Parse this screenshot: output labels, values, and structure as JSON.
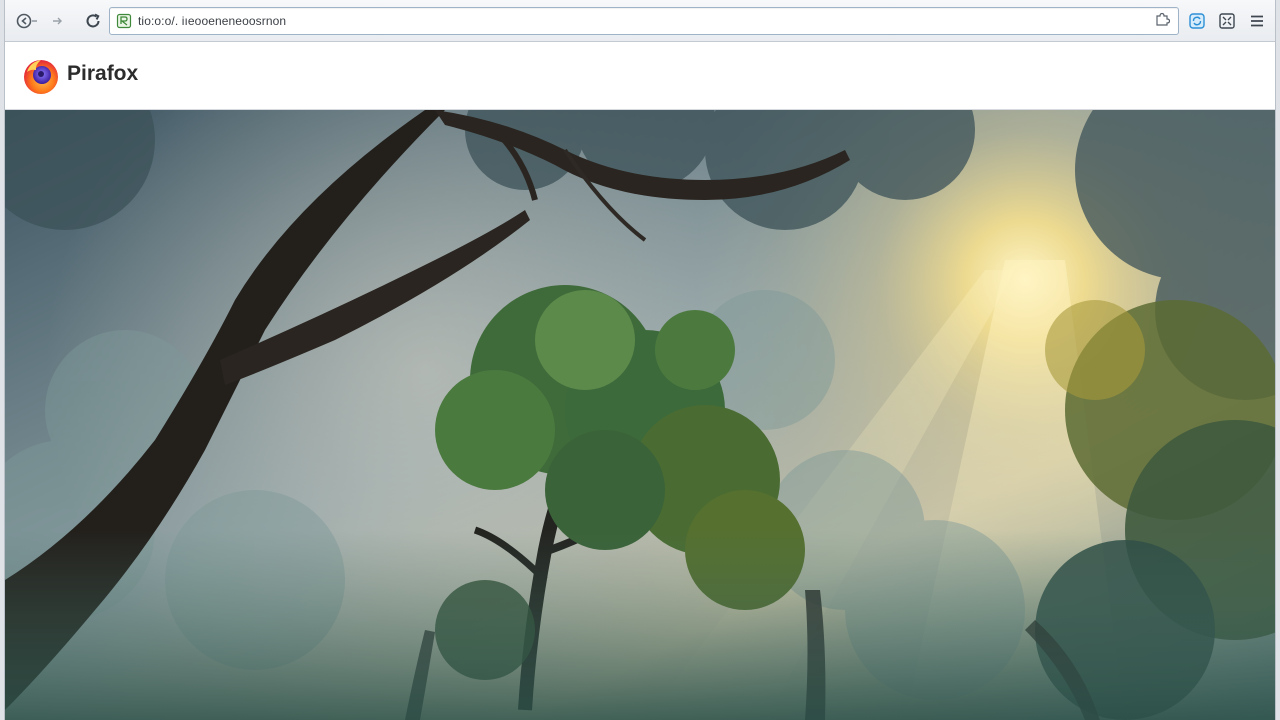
{
  "browser": {
    "url": "tio:o:o/. iıeooeneneoosrnon",
    "colors": {
      "toolbar": "#eef1f4",
      "url_border": "#9fb3c8",
      "accent": "#2b8fd6"
    },
    "icons": {
      "back": "back-icon",
      "reload": "reload-icon",
      "site": "site-shield-icon",
      "page_action": "puzzle-icon",
      "sync": "sync-icon",
      "extensions": "extensions-icon",
      "menu": "hamburger-menu-icon"
    }
  },
  "brand": {
    "name": "Pirafox",
    "logo": "firefox-logo"
  },
  "hero": {
    "subject": "misty-forest-sunlight"
  }
}
